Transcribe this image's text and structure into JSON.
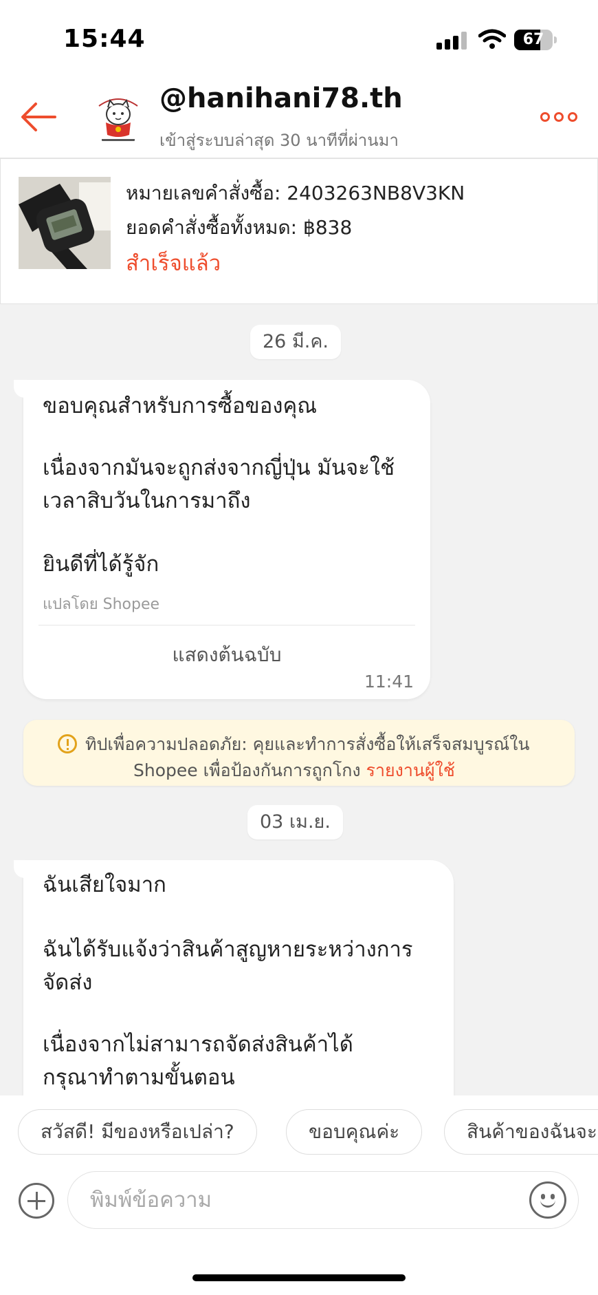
{
  "status_bar": {
    "time": "15:44",
    "battery": "67",
    "battery_level_percent": 67
  },
  "header": {
    "shop_name": "@hanihani78.th",
    "last_seen": "เข้าสู่ระบบล่าสุด 30 นาทีที่ผ่านมา",
    "back_icon": "arrow-left-icon",
    "more_icon": "more-dots-icon"
  },
  "order": {
    "number_text": "หมายเลขคำสั่งซื้อ: 2403263NB8V3KN",
    "total_text": "ยอดคำสั่งซื้อทั้งหมด: ฿838",
    "status": "สำเร็จแล้ว"
  },
  "dates": [
    "26 มี.ค.",
    "03 เม.ย."
  ],
  "messages": [
    {
      "lines": [
        "ขอบคุณสำหรับการซื้อของคุณ",
        "เนื่องจากมันจะถูกส่งจากญี่ปุ่น มันจะใช้",
        "เวลาสิบวันในการมาถึง",
        "ยินดีที่ได้รู้จัก"
      ],
      "translated_by": "แปลโดย Shopee",
      "show_original": "แสดงต้นฉบับ",
      "time": "11:41"
    },
    {
      "lines": [
        "ฉันเสียใจมาก",
        "ฉันได้รับแจ้งว่าสินค้าสูญหายระหว่างการ",
        "จัดส่ง",
        "เนื่องจากไม่สามารถจัดส่งสินค้าได้",
        "กรุณาทำตามขั้นตอน"
      ]
    }
  ],
  "safety_tip": {
    "line1": "ทิปเพื่อความปลอดภัย: คุยและทำการสั่งซื้อให้เสร็จสมบูรณ์ใน",
    "line2": "Shopee เพื่อป้องกันการถูกโกง ",
    "link": "รายงานผู้ใช้",
    "icon": "warning-circle-icon"
  },
  "quick_replies": [
    "สวัสดี! มีของหรือเปล่า?",
    "ขอบคุณค่ะ",
    "สินค้าของฉันจะ"
  ],
  "composer": {
    "placeholder": "พิมพ์ข้อความ",
    "add_icon": "plus-circle-icon",
    "emoji_icon": "emoji-smile-icon"
  },
  "colors": {
    "accent": "#ee4d2d",
    "tip_background": "#fff8e1",
    "background": "#f2f2f2"
  }
}
